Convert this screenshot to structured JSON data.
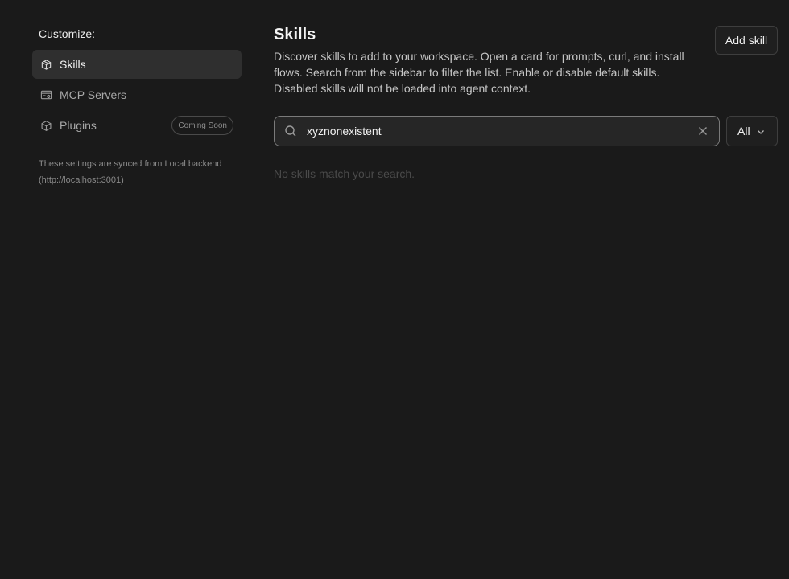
{
  "sidebar": {
    "heading": "Customize:",
    "items": [
      {
        "label": "Skills",
        "icon": "cube-stack-icon",
        "active": true
      },
      {
        "label": "MCP Servers",
        "icon": "server-settings-icon",
        "active": false
      },
      {
        "label": "Plugins",
        "icon": "package-icon",
        "active": false,
        "badge": "Coming Soon"
      }
    ],
    "sync_note": "These settings are synced from Local backend (http://localhost:3001)"
  },
  "main": {
    "title": "Skills",
    "description": "Discover skills to add to your workspace. Open a card for prompts, curl, and install flows. Search from the sidebar to filter the list. Enable or disable default skills. Disabled skills will not be loaded into agent context.",
    "add_button": "Add skill",
    "search": {
      "value": "xyznonexistent",
      "placeholder": ""
    },
    "filter": {
      "selected": "All"
    },
    "empty_message": "No skills match your search."
  },
  "colors": {
    "background": "#1a1a1a",
    "active_item": "#2f2f2f",
    "border": "#3e3e3e",
    "search_border": "#7a7a7a"
  }
}
